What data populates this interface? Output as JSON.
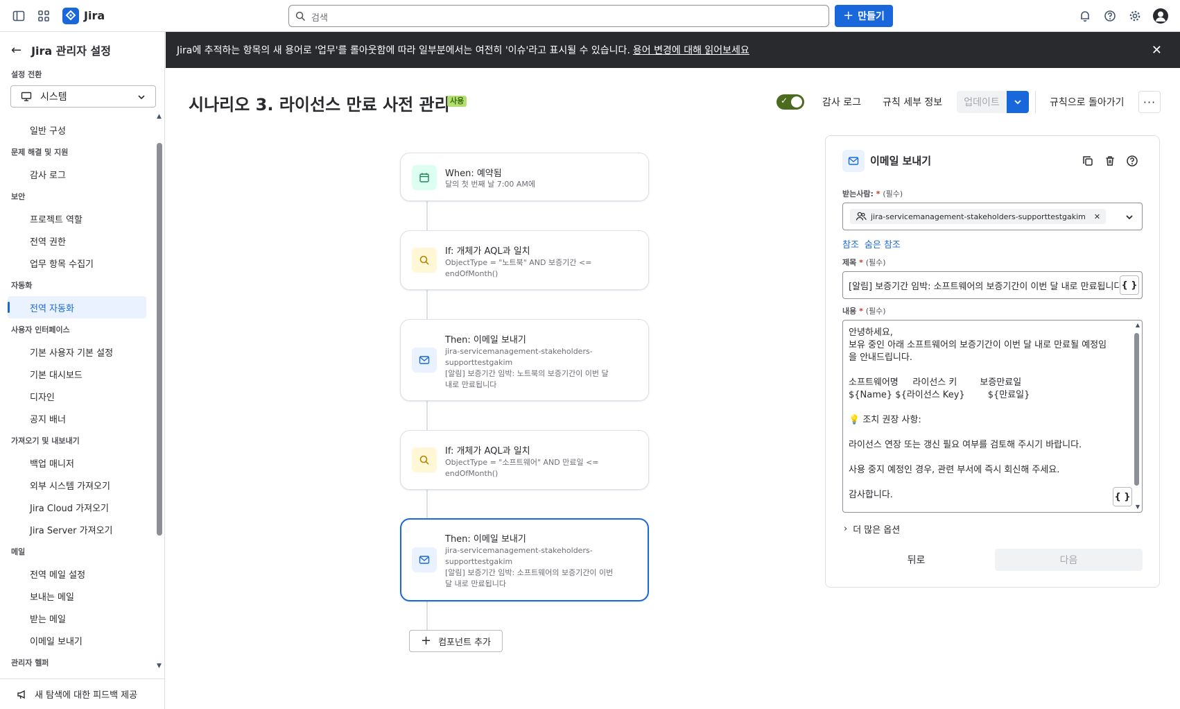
{
  "app": {
    "name": "Jira"
  },
  "search": {
    "placeholder": "검색"
  },
  "create_label": "만들기",
  "sidebar": {
    "back_label": "Jira 관리자 설정",
    "switch_label": "설정 전환",
    "switch_value": "시스템",
    "groups": [
      {
        "title": "",
        "items": [
          "일반 구성"
        ]
      },
      {
        "title": "문제 해결 및 지원",
        "items": [
          "감사 로그"
        ]
      },
      {
        "title": "보안",
        "items": [
          "프로젝트 역할",
          "전역 권한",
          "업무 항목 수집기"
        ]
      },
      {
        "title": "자동화",
        "items": [
          "전역 자동화"
        ]
      },
      {
        "title": "사용자 인터페이스",
        "items": [
          "기본 사용자 기본 설정",
          "기본 대시보드",
          "디자인",
          "공지 배너"
        ]
      },
      {
        "title": "가져오기 및 내보내기",
        "items": [
          "백업 매니저",
          "외부 시스템 가져오기",
          "Jira Cloud 가져오기",
          "Jira Server 가져오기"
        ]
      },
      {
        "title": "메일",
        "items": [
          "전역 메일 설정",
          "보내는 메일",
          "받는 메일",
          "이메일 보내기"
        ]
      },
      {
        "title": "관리자 헬퍼",
        "items": []
      }
    ],
    "feedback_label": "새 탐색에 대한 피드백 제공"
  },
  "banner": {
    "text": "Jira에 추적하는 항목의 새 용어로 '업무'를 롤아웃함에 따라 일부분에서는 여전히 '이슈'라고 표시될 수 있습니다.",
    "link": "용어 변경에 대해 읽어보세요"
  },
  "rule": {
    "title": "시나리오 3. 라이선스 만료 사전 관리",
    "status": "사용",
    "audit_log": "감사 로그",
    "rule_details": "규칙 세부 정보",
    "update": "업데이트",
    "back_to_rules": "규칙으로 돌아가기"
  },
  "flow": {
    "nodes": [
      {
        "kind": "when",
        "title": "When: 예약됨",
        "lines": [
          "달의 첫 번째 날 7:00 AM에"
        ]
      },
      {
        "kind": "if",
        "title": "If: 개체가 AQL과 일치",
        "lines": [
          "ObjectType = \"노트북\" AND 보증기간 <=",
          "endOfMonth()"
        ]
      },
      {
        "kind": "then",
        "title": "Then: 이메일 보내기",
        "lines": [
          "jira-servicemanagement-stakeholders-",
          "supporttestgakim",
          "[알림] 보증기간 임박: 노트북의 보증기간이 이번 달",
          "내로 만료됩니다"
        ]
      },
      {
        "kind": "if",
        "title": "If: 개체가 AQL과 일치",
        "lines": [
          "ObjectType = \"소프트웨어\" AND 만료일 <=",
          "endOfMonth()"
        ]
      },
      {
        "kind": "then",
        "title": "Then: 이메일 보내기",
        "lines": [
          "jira-servicemanagement-stakeholders-",
          "supporttestgakim",
          "[알림] 보증기간 임박: 소프트웨어의 보증기간이 이번",
          "달 내로 만료됩니다"
        ]
      }
    ],
    "add_component": "컴포넌트 추가"
  },
  "panel": {
    "title": "이메일 보내기",
    "to_label": "받는사람:",
    "required": "(필수)",
    "recipient": "jira-servicemanagement-stakeholders-supporttestgakim",
    "cc": "참조",
    "bcc": "숨은 참조",
    "subject_label": "제목",
    "subject": "[알림] 보증기간 임박: 소프트웨어의 보증기간이 이번 달 내로 만료됩니다",
    "body_label": "내용",
    "body_lines": [
      "안녕하세요,",
      "보유 중인 아래 소프트웨어의 보증기간이 이번 달 내로 만료될 예정임",
      "을 안내드립니다.",
      "",
      "소프트웨어명     라이선스 키        보증만료일",
      "${Name} ${라이선스 Key}        ${만료일}",
      "",
      "💡 조치 권장 사항:",
      "",
      "라이선스 연장 또는 갱신 필요 여부를 검토해 주시기 바랍니다.",
      "",
      "사용 중지 예정인 경우, 관련 부서에 즉시 회신해 주세요.",
      "",
      "감사합니다."
    ],
    "more_options": "더 많은 옵션",
    "back": "뒤로",
    "next": "다음"
  },
  "colors": {
    "brand": "#1868db",
    "banner_bg": "#292a2e",
    "status_bg": "#b3df72",
    "toggle_on": "#4c6b1f"
  }
}
